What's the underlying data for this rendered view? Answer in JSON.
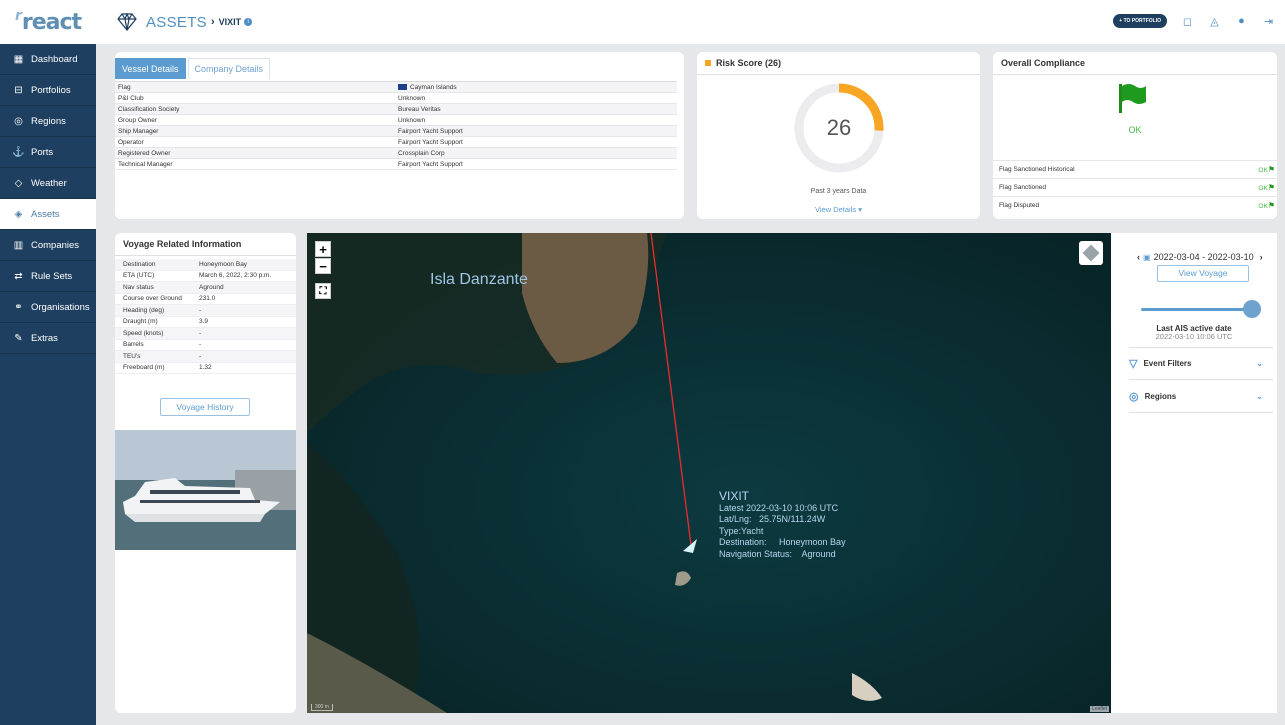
{
  "app": {
    "logo_prefix": "r",
    "logo": "react"
  },
  "sidebar": {
    "items": [
      {
        "label": "Dashboard",
        "icon": "dashboard-icon",
        "glyph": "▦"
      },
      {
        "label": "Portfolios",
        "icon": "portfolio-icon",
        "glyph": "⊟"
      },
      {
        "label": "Regions",
        "icon": "location-pin-icon",
        "glyph": "◎"
      },
      {
        "label": "Ports",
        "icon": "anchor-icon",
        "glyph": "⚓"
      },
      {
        "label": "Weather",
        "icon": "weather-icon",
        "glyph": "◇"
      },
      {
        "label": "Assets",
        "icon": "diamond-icon",
        "glyph": "◈"
      },
      {
        "label": "Companies",
        "icon": "companies-icon",
        "glyph": "▥"
      },
      {
        "label": "Rule Sets",
        "icon": "sliders-icon",
        "glyph": "⇄"
      },
      {
        "label": "Organisations",
        "icon": "people-icon",
        "glyph": "⚭"
      },
      {
        "label": "Extras",
        "icon": "wrench-icon",
        "glyph": "✎"
      }
    ],
    "active": "Assets"
  },
  "header": {
    "section": "ASSETS",
    "separator": "›",
    "asset": "VIXIT",
    "portfolio_btn": "+ TO PORTFOLIO"
  },
  "vessel": {
    "tabs": [
      "Vessel Details",
      "Company Details"
    ],
    "rows": [
      {
        "k": "Flag",
        "v": "Cayman Islands"
      },
      {
        "k": "P&I Club",
        "v": "Unknown"
      },
      {
        "k": "Classification Society",
        "v": "Bureau Veritas"
      },
      {
        "k": "Group Owner",
        "v": "Unknown"
      },
      {
        "k": "Ship Manager",
        "v": "Fairport Yacht Support"
      },
      {
        "k": "Operator",
        "v": "Fairport Yacht Support"
      },
      {
        "k": "Registered Owner",
        "v": "Crossplain Corp"
      },
      {
        "k": "Technical Manager",
        "v": "Fairport Yacht Support"
      }
    ]
  },
  "risk": {
    "title": "Risk Score (26)",
    "score": "26",
    "score_value": 26,
    "max": 100,
    "sub": "Past 3 years Data",
    "link": "View Details ▾",
    "accent": "#f6a623"
  },
  "compliance": {
    "title": "Overall Compliance",
    "status": "OK",
    "rows": [
      {
        "k": "Flag Sanctioned Historical",
        "v": "OK"
      },
      {
        "k": "Flag Sanctioned",
        "v": "OK"
      },
      {
        "k": "Flag Disputed",
        "v": "OK"
      }
    ]
  },
  "voyage": {
    "title": "Voyage Related Information",
    "rows": [
      {
        "k": "Destination",
        "v": "Honeymoon Bay"
      },
      {
        "k": "ETA (UTC)",
        "v": "March 6, 2022, 2:30 p.m."
      },
      {
        "k": "Nav status",
        "v": "Aground"
      },
      {
        "k": "Course over Ground",
        "v": "231.0"
      },
      {
        "k": "Heading (deg)",
        "v": "-"
      },
      {
        "k": "Draught (m)",
        "v": "3.9"
      },
      {
        "k": "Speed (knots)",
        "v": "-"
      },
      {
        "k": "Barrels",
        "v": "-"
      },
      {
        "k": "TEU's",
        "v": "-"
      },
      {
        "k": "Freeboard (m)",
        "v": "1.32"
      }
    ],
    "history_btn": "Voyage History"
  },
  "map": {
    "place": "Isla Danzante",
    "zoom_in": "+",
    "zoom_out": "−",
    "fullscreen": "⛶",
    "scale": "300 m",
    "attribution": "Leaflet",
    "popup": {
      "name": "VIXIT",
      "latest": "Latest 2022-03-10 10:06 UTC",
      "latlng": "Lat/Lng:   25.75N/111.24W",
      "type": "Type:Yacht",
      "destination": "Destination:     Honeymoon Bay",
      "nav": "Navigation Status:    Aground"
    }
  },
  "side": {
    "prev": "‹",
    "next": "›",
    "date_range": "2022-03-04 - 2022-03-10",
    "view_voyage": "View Voyage",
    "slider_value": 1.0,
    "last_ais_label": "Last AIS active date",
    "last_ais_date": "2022-03-10 10:06 UTC",
    "filters": [
      {
        "label": "Event Filters",
        "icon": "funnel-icon"
      },
      {
        "label": "Regions",
        "icon": "location-pin-icon"
      }
    ]
  }
}
